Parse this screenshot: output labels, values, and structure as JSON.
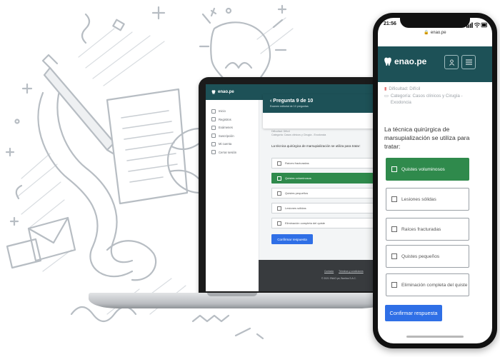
{
  "colors": {
    "brand": "#1d5157",
    "selected": "#2f8a4c",
    "primary_button": "#2f6fe6",
    "footer": "#383b3e"
  },
  "laptop": {
    "brand_name": "enao.pe",
    "nav": [
      {
        "label": "Inicio",
        "icon": "home-icon"
      },
      {
        "label": "Registros",
        "icon": "list-icon"
      },
      {
        "label": "Exámenes",
        "icon": "exam-icon"
      },
      {
        "label": "Suscripción",
        "icon": "card-icon"
      },
      {
        "label": "Mi cuenta",
        "icon": "user-icon"
      },
      {
        "label": "Cerrar sesión",
        "icon": "logout-icon"
      }
    ],
    "question_title": "Pregunta 9 de 10",
    "question_subtitle": "Examen editorial de 10 preguntas",
    "meta_line1": "Dificultad: Difícil",
    "meta_line2": "Categoría: Casos clínicos y Cirugía - Exodoncia",
    "question": "La técnica quirúrgica de marsupialización se utiliza para tratar:",
    "options": [
      "Raíces fracturadas",
      "Quistes voluminosos",
      "Quistes pequeños",
      "Lesiones sólidas",
      "Eliminación completa del quiste"
    ],
    "selected_index": 1,
    "confirm_label": "Confirmar respuesta",
    "footer_links": [
      "Contacto",
      "Términos y condiciones"
    ],
    "footer_copy": "© 2021 ENAO.pe, Bonitos S.A.C."
  },
  "phone": {
    "time": "21:56",
    "url": "enao.pe",
    "brand_name": "enao.pe",
    "difficulty": "Dificultad: Difícil",
    "category": "Categoría: Casos clínicos y Cirugía - Exodoncia",
    "question": "La técnica quirúrgica de marsupialización se utiliza para tratar:",
    "options": [
      "Quistes voluminosos",
      "Lesiones sólidas",
      "Raíces fracturadas",
      "Quistes pequeños",
      "Eliminación completa del quiste"
    ],
    "selected_index": 0,
    "confirm_label": "Confirmar respuesta"
  }
}
